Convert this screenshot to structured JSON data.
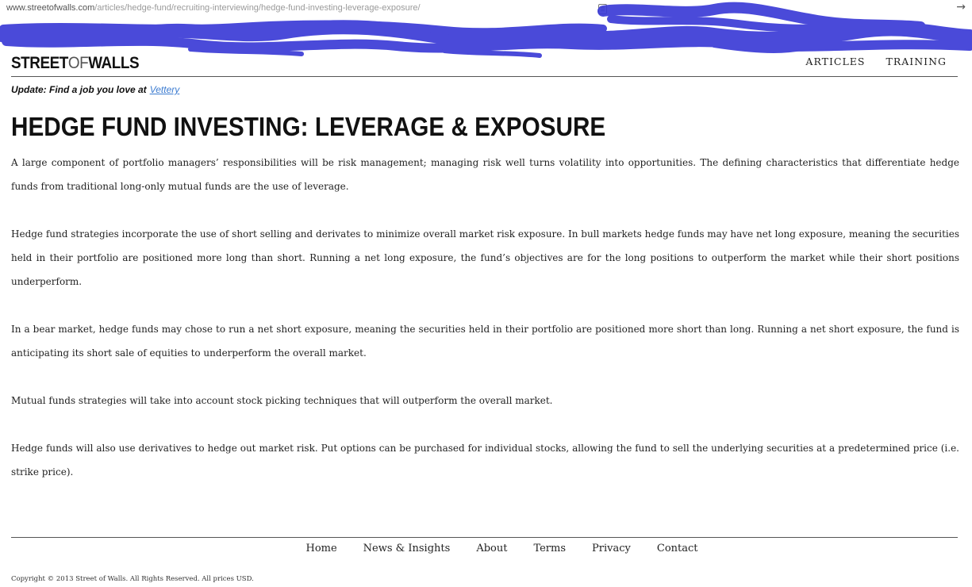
{
  "browser": {
    "url_host": "www.streetofwalls.com",
    "url_path": "/articles/hedge-fund/recruiting-interviewing/hedge-fund-investing-leverage-exposure/",
    "redaction_color": "#3b3bd6"
  },
  "site": {
    "logo_part1": "STREET",
    "logo_part2": "OF",
    "logo_part3": "WALLS"
  },
  "nav": {
    "articles": "ARTICLES",
    "training": "TRAINING"
  },
  "update": {
    "text": "Update: Find a job you love at",
    "link": "Vettery"
  },
  "article": {
    "title": "HEDGE FUND INVESTING: LEVERAGE & EXPOSURE",
    "paragraphs": [
      "A large component of portfolio managers’ responsibilities will be risk management; managing risk well turns volatility into opportunities.  The defining characteristics that differentiate hedge funds from traditional long-only mutual funds are the use of leverage.",
      "Hedge fund strategies incorporate the use of short selling and derivates to minimize overall market risk exposure.  In bull markets hedge funds may have net long exposure, meaning the securities held in their portfolio are positioned more long than short.  Running a net long exposure, the fund’s objectives are for the long positions to outperform the market while their short positions underperform.",
      "In a bear market, hedge funds may chose to run a net short exposure, meaning the securities held in their portfolio are positioned more short than long.  Running a net short exposure, the fund is anticipating its short sale of equities to underperform the overall market.",
      "Mutual funds strategies will take into account stock picking techniques that will outperform the overall market.",
      "Hedge funds will also use derivatives to hedge out market risk. Put options can be purchased for individual stocks, allowing the fund to sell the underlying securities at a predetermined price (i.e. strike price)."
    ]
  },
  "footer": {
    "links": [
      "Home",
      "News & Insights",
      "About",
      "Terms",
      "Privacy",
      "Contact"
    ],
    "copyright": "Copyright © 2013 Street of Walls. All Rights Reserved. All prices USD."
  },
  "icons": {
    "reader": "reader-view-icon",
    "go": "go-arrow-icon"
  }
}
